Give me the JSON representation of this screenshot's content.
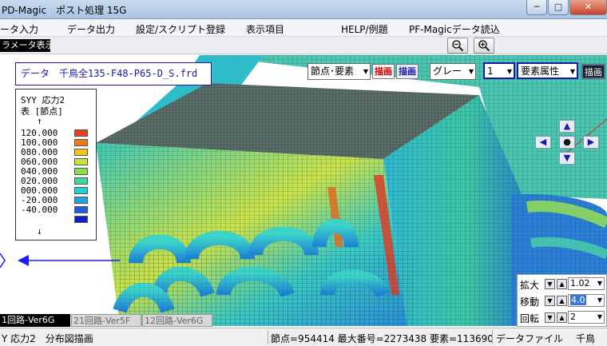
{
  "window": {
    "title": "PD-Magic　ポスト処理 15G",
    "min_glyph": "─",
    "max_glyph": "□",
    "close_glyph": "✕"
  },
  "menu": {
    "items": [
      "ータ入力",
      "データ出力",
      "設定/スクリプト登録",
      "表示項目",
      "HELP/例題",
      "PF-Magicデータ読込"
    ]
  },
  "toolbar": {
    "param_label": "ラメータ表示",
    "zoom_out_icon": "magnifier-minus-icon",
    "zoom_in_icon": "magnifier-plus-icon"
  },
  "viewport": {
    "data_label": "データ　千鳥全135-F48-P65-D_S.frd",
    "node_element_select": "節点･要素",
    "draw_red_label": "描画",
    "draw_blue_label": "描画",
    "color_select": "グレー",
    "number_select": "1",
    "attribute_select": "要素属性",
    "draw_dark_label": "描画",
    "background_color": "#ffffff",
    "arrow_color": "#1a1aff"
  },
  "legend": {
    "title_line1": "SYY 応力2",
    "title_line2": "表 [節点]",
    "arrow_up": "↑",
    "arrow_down": "↓",
    "items": [
      {
        "value": "120.000",
        "color": "#e8401c"
      },
      {
        "value": "100.000",
        "color": "#f07a18"
      },
      {
        "value": "080.000",
        "color": "#f5c31a"
      },
      {
        "value": "060.000",
        "color": "#c6e33a"
      },
      {
        "value": "040.000",
        "color": "#8de04a"
      },
      {
        "value": "020.000",
        "color": "#3fd7a0"
      },
      {
        "value": "000.000",
        "color": "#20cfd9"
      },
      {
        "value": "-20.000",
        "color": "#1fa3e6"
      },
      {
        "value": "-40.000",
        "color": "#1760e0"
      },
      {
        "value": "",
        "color": "#1020c8"
      }
    ]
  },
  "navpad": {
    "up": "▲",
    "down": "▼",
    "left": "◀",
    "right": "▶",
    "center": "●"
  },
  "transform": {
    "scale_label": "拡大",
    "scale_value": "1.02",
    "move_label": "移動",
    "move_value": "4.0",
    "rotate_label": "回転",
    "rotate_value": "2"
  },
  "tabs": [
    "1回路-Ver6G",
    "21回路-Ver5F",
    "12回路-Ver6G"
  ],
  "status": {
    "left": "Y 応力2　分布図描画",
    "nodes": "節点=954414 最大番号=2273438 要素=113690",
    "file_label": "データファイル",
    "file_value": "千鳥"
  }
}
